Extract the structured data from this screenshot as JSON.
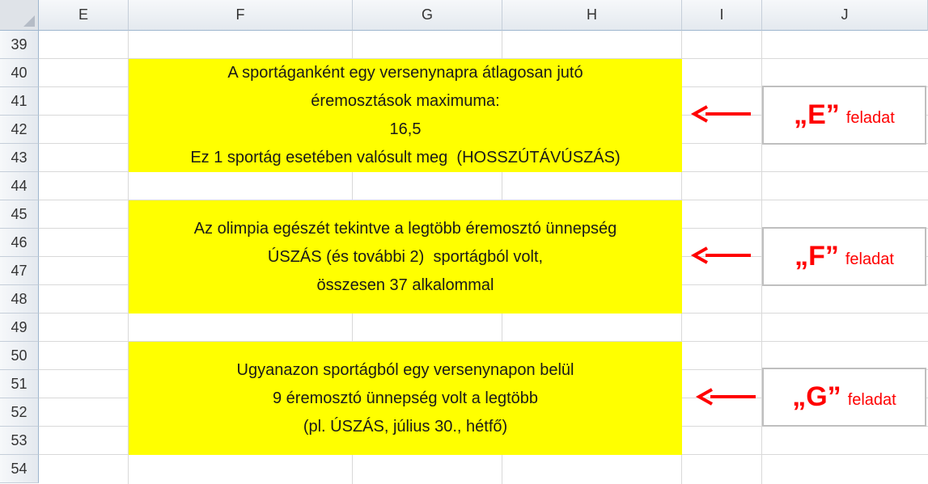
{
  "sheet": {
    "columns": [
      "E",
      "F",
      "G",
      "H",
      "I",
      "J"
    ],
    "rows": [
      "39",
      "40",
      "41",
      "42",
      "43",
      "44",
      "45",
      "46",
      "47",
      "48",
      "49",
      "50",
      "51",
      "52",
      "53",
      "54"
    ]
  },
  "boxes": [
    {
      "lines": [
        "A sportáganként egy versenynapra átlagosan jutó",
        "éremosztások maximuma:",
        "16,5",
        "Ez 1 sportág esetében valósult meg  (HOSSZÚTÁVÚSZÁS)"
      ]
    },
    {
      "lines": [
        "Az olimpia egészét tekintve a legtöbb éremosztó ünnepség",
        "ÚSZÁS (és további 2)  sportágból volt,",
        "összesen 37 alkalommal"
      ]
    },
    {
      "lines": [
        "Ugyanazon sportágból egy versenynapon belül",
        "9 éremosztó ünnepség volt a legtöbb",
        "(pl. ÚSZÁS, július 30., hétfő)"
      ]
    }
  ],
  "tasks": [
    {
      "letter": "„E”",
      "word": "feladat"
    },
    {
      "letter": "„F”",
      "word": "feladat"
    },
    {
      "letter": "„G”",
      "word": "feladat"
    }
  ],
  "colors": {
    "highlight": "#ffff00",
    "arrow": "#ff0000",
    "task_text": "#ff0000"
  }
}
